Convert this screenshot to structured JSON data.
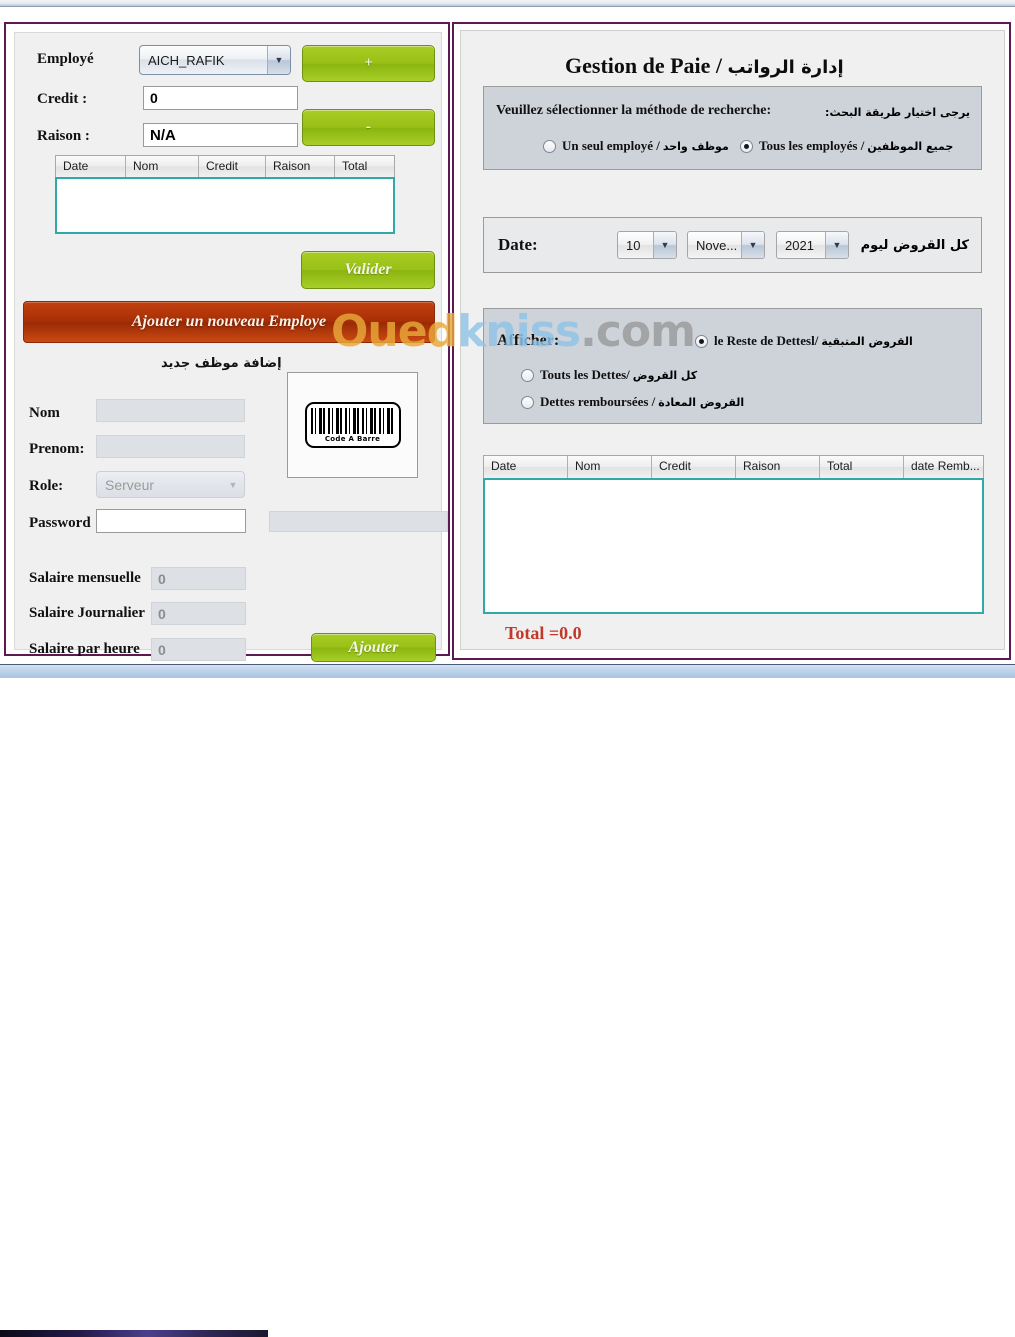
{
  "left_panel": {
    "employe_label": "Employé",
    "employe_value": "AICH_RAFIK",
    "add_credit_button": "+",
    "remove_credit_button": "-",
    "credit_label": "Credit :",
    "credit_value": "0",
    "raison_label": "Raison :",
    "raison_value": "N/A",
    "credit_table": {
      "columns": [
        "Date",
        "Nom",
        "Credit",
        "Raison",
        "Total"
      ],
      "rows": []
    },
    "valider_button": "Valider",
    "add_employee_button": "Ajouter un nouveau Employe",
    "add_employee_title_ar": "إضافة موظف جديد",
    "nom_label": "Nom",
    "nom_value": "",
    "prenom_label": "Prenom:",
    "prenom_value": "",
    "role_label": "Role:",
    "role_value": "Serveur",
    "password_label": "Password",
    "password_value": "",
    "barcode_caption": "Code A Barre",
    "salaire_mensuelle_label": "Salaire mensuelle",
    "salaire_mensuelle_value": "0",
    "salaire_journalier_label": "Salaire Journalier",
    "salaire_journalier_value": "0",
    "salaire_heure_label": "Salaire par heure",
    "salaire_heure_value": "0",
    "ajouter_button": "Ajouter"
  },
  "right_panel": {
    "title_fr": "Gestion de Paie / ",
    "title_ar": "إدارة الرواتب",
    "search_method": {
      "question_fr": "Veuillez sélectionner la méthode de recherche:",
      "question_ar": "يرجى اختيار طريقة البحث:",
      "options": [
        {
          "label": "Un seul employé / ",
          "label_ar": "موظف واحد",
          "selected": false
        },
        {
          "label": "Tous les employés / ",
          "label_ar": "جميع الموظفين",
          "selected": true
        }
      ]
    },
    "date_section": {
      "date_label": "Date:",
      "day": "10",
      "month": "Nove...",
      "year": "2021",
      "caption_ar": "كل القروض ليوم"
    },
    "afficher_section": {
      "afficher_label": "Afficher:",
      "options": [
        {
          "label": "le Reste de Dettesl/",
          "label_ar": "القروض المتبقية",
          "selected": true
        },
        {
          "label": "Touts les Dettes/",
          "label_ar": "كل القروض",
          "selected": false
        },
        {
          "label": "Dettes remboursées / ",
          "label_ar": "القروض المعادة",
          "selected": false
        }
      ]
    },
    "debt_table": {
      "columns": [
        "Date",
        "Nom",
        "Credit",
        "Raison",
        "Total",
        "date Remb..."
      ],
      "rows": []
    },
    "total_label": "Total =0.0"
  },
  "watermark": {
    "part1": "Oued",
    "part2": "kniss",
    "part3": ".com"
  },
  "colors": {
    "frame": "#5b1a52",
    "green_button": "#99c018",
    "red_button": "#a82f06",
    "table_border": "#31a9a9",
    "total_text": "#c0392b",
    "groupbox": "#ced3da"
  }
}
